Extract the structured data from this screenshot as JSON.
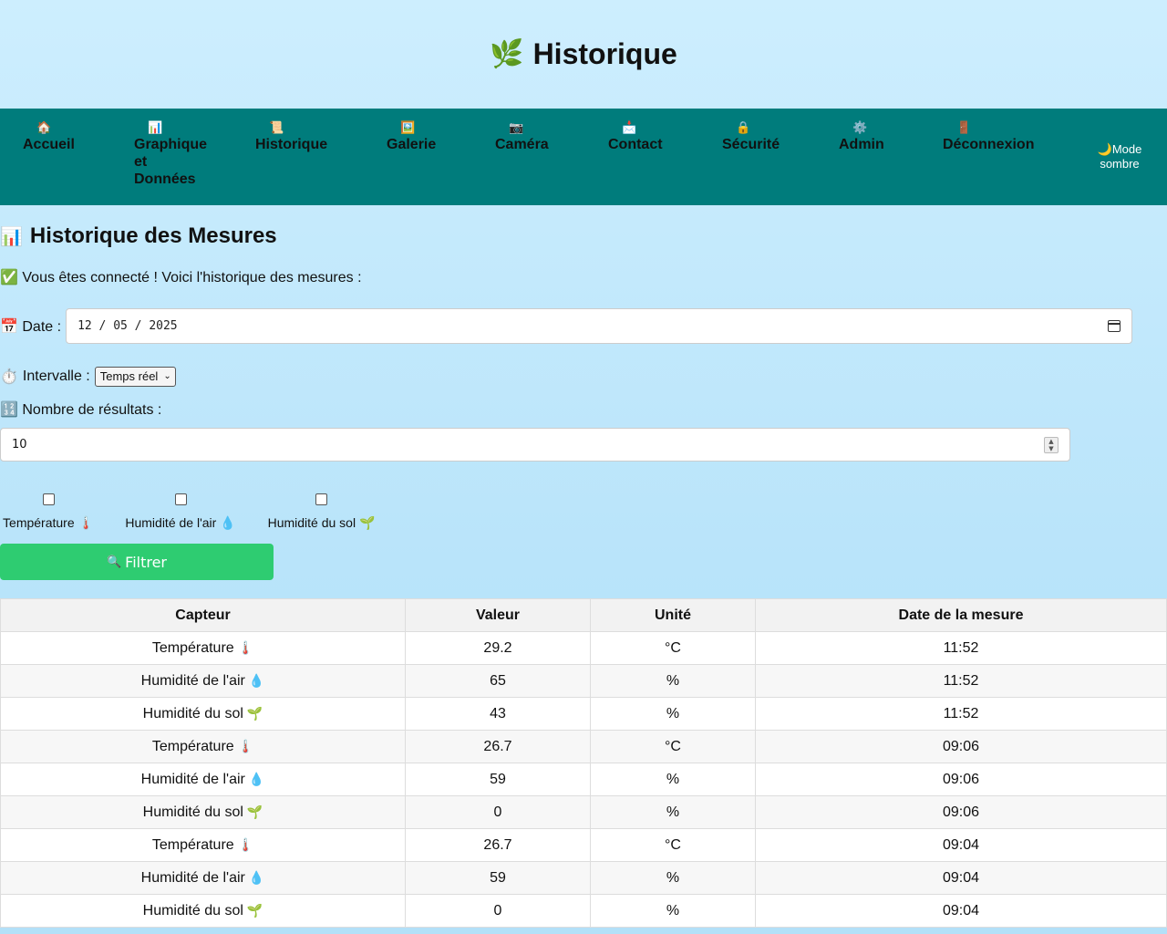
{
  "header": {
    "icon": "🌿",
    "title": "Historique"
  },
  "nav": {
    "items": [
      {
        "icon": "🏠",
        "label": "Accueil"
      },
      {
        "icon": "📊",
        "label": "Graphique et Données"
      },
      {
        "icon": "📜",
        "label": "Historique"
      },
      {
        "icon": "🖼️",
        "label": "Galerie"
      },
      {
        "icon": "📷",
        "label": "Caméra"
      },
      {
        "icon": "📩",
        "label": "Contact"
      },
      {
        "icon": "🔒",
        "label": "Sécurité"
      },
      {
        "icon": "⚙️",
        "label": "Admin"
      },
      {
        "icon": "🚪",
        "label": "Déconnexion"
      }
    ],
    "dark_mode": {
      "icon": "🌙",
      "label": "Mode sombre"
    }
  },
  "main": {
    "title_icon": "📊",
    "title": "Historique des Mesures",
    "notice_icon": "✅",
    "notice": "Vous êtes connecté ! Voici l'historique des mesures :",
    "date_icon": "📅",
    "date_label": "Date :",
    "date_value": "12 / 05 / 2025",
    "interval_icon": "⏱️",
    "interval_label": "Intervalle :",
    "interval_value": "Temps réel",
    "count_icon": "🔢",
    "count_label": "Nombre de résultats :",
    "count_value": "10",
    "checkboxes": [
      {
        "label": "Température",
        "icon": "🌡️",
        "checked": false
      },
      {
        "label": "Humidité de l'air",
        "icon": "💧",
        "checked": false
      },
      {
        "label": "Humidité du sol",
        "icon": "🌱",
        "checked": false
      }
    ],
    "filter_icon": "🔍",
    "filter_label": "Filtrer"
  },
  "table": {
    "headers": [
      "Capteur",
      "Valeur",
      "Unité",
      "Date de la mesure"
    ],
    "rows": [
      {
        "sensor": "Température",
        "icon": "🌡️",
        "value": "29.2",
        "unit": "°C",
        "date": "11:52"
      },
      {
        "sensor": "Humidité de l'air",
        "icon": "💧",
        "value": "65",
        "unit": "%",
        "date": "11:52"
      },
      {
        "sensor": "Humidité du sol",
        "icon": "🌱",
        "value": "43",
        "unit": "%",
        "date": "11:52"
      },
      {
        "sensor": "Température",
        "icon": "🌡️",
        "value": "26.7",
        "unit": "°C",
        "date": "09:06"
      },
      {
        "sensor": "Humidité de l'air",
        "icon": "💧",
        "value": "59",
        "unit": "%",
        "date": "09:06"
      },
      {
        "sensor": "Humidité du sol",
        "icon": "🌱",
        "value": "0",
        "unit": "%",
        "date": "09:06"
      },
      {
        "sensor": "Température",
        "icon": "🌡️",
        "value": "26.7",
        "unit": "°C",
        "date": "09:04"
      },
      {
        "sensor": "Humidité de l'air",
        "icon": "💧",
        "value": "59",
        "unit": "%",
        "date": "09:04"
      },
      {
        "sensor": "Humidité du sol",
        "icon": "🌱",
        "value": "0",
        "unit": "%",
        "date": "09:04"
      }
    ]
  }
}
